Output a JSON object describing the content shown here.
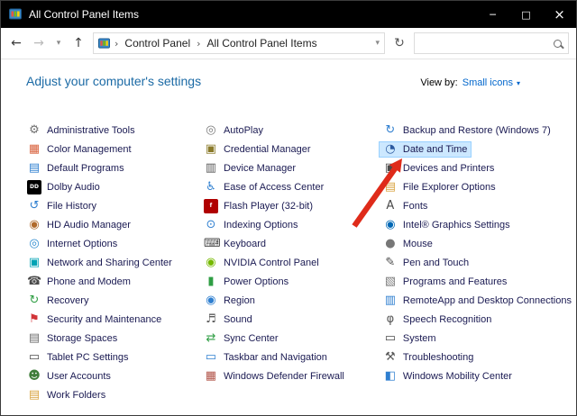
{
  "window": {
    "title": "All Control Panel Items",
    "controls": {
      "minimize": "─",
      "maximize": "□",
      "close": "×"
    }
  },
  "navbar": {
    "back_icon": "←",
    "forward_icon": "→",
    "dropdown_icon": "▾",
    "up_icon": "↑",
    "refresh_icon": "↻",
    "breadcrumb": {
      "root": "Control Panel",
      "current": "All Control Panel Items",
      "separator": "›",
      "chevron": "▾"
    },
    "search": {
      "value": "",
      "placeholder": ""
    }
  },
  "header": {
    "title": "Adjust your computer's settings",
    "view_by_label": "View by:",
    "view_by_value": "Small icons",
    "view_by_chevron": "▾"
  },
  "columns": [
    {
      "items": [
        {
          "label": "Administrative Tools",
          "icon": "administrative-tools-icon",
          "glyph": "⚙",
          "fg": "#707070"
        },
        {
          "label": "Color Management",
          "icon": "color-management-icon",
          "glyph": "▦",
          "fg": "#d8603b"
        },
        {
          "label": "Default Programs",
          "icon": "default-programs-icon",
          "glyph": "▤",
          "fg": "#2f7fd0"
        },
        {
          "label": "Dolby Audio",
          "icon": "dolby-audio-icon",
          "glyph": "DD",
          "fg": "#ffffff",
          "bg": "#000000"
        },
        {
          "label": "File History",
          "icon": "file-history-icon",
          "glyph": "↺",
          "fg": "#2f7fd0"
        },
        {
          "label": "HD Audio Manager",
          "icon": "hd-audio-manager-icon",
          "glyph": "◉",
          "fg": "#b06a2c"
        },
        {
          "label": "Internet Options",
          "icon": "internet-options-icon",
          "glyph": "◎",
          "fg": "#2e8bd0"
        },
        {
          "label": "Network and Sharing Center",
          "icon": "network-sharing-center-icon",
          "glyph": "▣",
          "fg": "#00a3b4"
        },
        {
          "label": "Phone and Modem",
          "icon": "phone-and-modem-icon",
          "glyph": "☎",
          "fg": "#4a4a4a"
        },
        {
          "label": "Recovery",
          "icon": "recovery-icon",
          "glyph": "↻",
          "fg": "#2f9e44"
        },
        {
          "label": "Security and Maintenance",
          "icon": "security-and-maintenance-icon",
          "glyph": "⚑",
          "fg": "#d13438"
        },
        {
          "label": "Storage Spaces",
          "icon": "storage-spaces-icon",
          "glyph": "▤",
          "fg": "#6d6d6d"
        },
        {
          "label": "Tablet PC Settings",
          "icon": "tablet-pc-settings-icon",
          "glyph": "▭",
          "fg": "#4a4a4a"
        },
        {
          "label": "User Accounts",
          "icon": "user-accounts-icon",
          "glyph": "☻",
          "fg": "#3f7d3a"
        },
        {
          "label": "Work Folders",
          "icon": "work-folders-icon",
          "glyph": "▤",
          "fg": "#d9a441"
        }
      ]
    },
    {
      "items": [
        {
          "label": "AutoPlay",
          "icon": "autoplay-icon",
          "glyph": "◎",
          "fg": "#7a7a7a"
        },
        {
          "label": "Credential Manager",
          "icon": "credential-manager-icon",
          "glyph": "▣",
          "fg": "#8a7a2a"
        },
        {
          "label": "Device Manager",
          "icon": "device-manager-icon",
          "glyph": "▥",
          "fg": "#5a5a5a"
        },
        {
          "label": "Ease of Access Center",
          "icon": "ease-of-access-center-icon",
          "glyph": "♿",
          "fg": "#2f7fd0"
        },
        {
          "label": "Flash Player (32-bit)",
          "icon": "flash-player-icon",
          "glyph": "f",
          "fg": "#ffffff",
          "bg": "#b00000"
        },
        {
          "label": "Indexing Options",
          "icon": "indexing-options-icon",
          "glyph": "⊙",
          "fg": "#2f7fd0"
        },
        {
          "label": "Keyboard",
          "icon": "keyboard-icon",
          "glyph": "⌨",
          "fg": "#4a4a4a"
        },
        {
          "label": "NVIDIA Control Panel",
          "icon": "nvidia-control-panel-icon",
          "glyph": "◉",
          "fg": "#76b900"
        },
        {
          "label": "Power Options",
          "icon": "power-options-icon",
          "glyph": "▮",
          "fg": "#2f9e44"
        },
        {
          "label": "Region",
          "icon": "region-icon",
          "glyph": "◉",
          "fg": "#2f7fd0"
        },
        {
          "label": "Sound",
          "icon": "sound-icon",
          "glyph": "♬",
          "fg": "#5a5a5a"
        },
        {
          "label": "Sync Center",
          "icon": "sync-center-icon",
          "glyph": "⇄",
          "fg": "#2f9e44"
        },
        {
          "label": "Taskbar and Navigation",
          "icon": "taskbar-and-navigation-icon",
          "glyph": "▭",
          "fg": "#2f7fd0"
        },
        {
          "label": "Windows Defender Firewall",
          "icon": "windows-defender-firewall-icon",
          "glyph": "▦",
          "fg": "#b2554a"
        }
      ]
    },
    {
      "items": [
        {
          "label": "Backup and Restore (Windows 7)",
          "icon": "backup-and-restore-icon",
          "glyph": "↻",
          "fg": "#2f7fd0"
        },
        {
          "label": "Date and Time",
          "icon": "date-and-time-icon",
          "glyph": "◔",
          "fg": "#2c5aa0",
          "highlighted": true
        },
        {
          "label": "Devices and Printers",
          "icon": "devices-and-printers-icon",
          "glyph": "▣",
          "fg": "#4a4a4a"
        },
        {
          "label": "File Explorer Options",
          "icon": "file-explorer-options-icon",
          "glyph": "▤",
          "fg": "#d9a441"
        },
        {
          "label": "Fonts",
          "icon": "fonts-icon",
          "glyph": "A",
          "fg": "#4a4a4a"
        },
        {
          "label": "Intel® Graphics Settings",
          "icon": "intel-graphics-settings-icon",
          "glyph": "◉",
          "fg": "#0068b5"
        },
        {
          "label": "Mouse",
          "icon": "mouse-icon",
          "glyph": "●",
          "fg": "#777777"
        },
        {
          "label": "Pen and Touch",
          "icon": "pen-and-touch-icon",
          "glyph": "✎",
          "fg": "#4a4a4a"
        },
        {
          "label": "Programs and Features",
          "icon": "programs-and-features-icon",
          "glyph": "▧",
          "fg": "#7a7a7a"
        },
        {
          "label": "RemoteApp and Desktop Connections",
          "icon": "remoteapp-desktop-connections-icon",
          "glyph": "▥",
          "fg": "#2f7fd0"
        },
        {
          "label": "Speech Recognition",
          "icon": "speech-recognition-icon",
          "glyph": "φ",
          "fg": "#5a5a5a"
        },
        {
          "label": "System",
          "icon": "system-icon",
          "glyph": "▭",
          "fg": "#4a4a4a"
        },
        {
          "label": "Troubleshooting",
          "icon": "troubleshooting-icon",
          "glyph": "⚒",
          "fg": "#5a5a5a"
        },
        {
          "label": "Windows Mobility Center",
          "icon": "windows-mobility-center-icon",
          "glyph": "◧",
          "fg": "#2f7fd0"
        }
      ]
    }
  ],
  "annotation": {
    "arrow_color": "#df2b1a",
    "points_to": "Date and Time"
  },
  "colors": {
    "titlebar_bg": "#000000",
    "header_text": "#1b6aa5",
    "link_blue": "#0066cc",
    "item_text": "#1a1a52",
    "highlight_bg": "#cce8ff",
    "highlight_border": "#99d1ff",
    "arrow_red": "#df2b1a"
  }
}
